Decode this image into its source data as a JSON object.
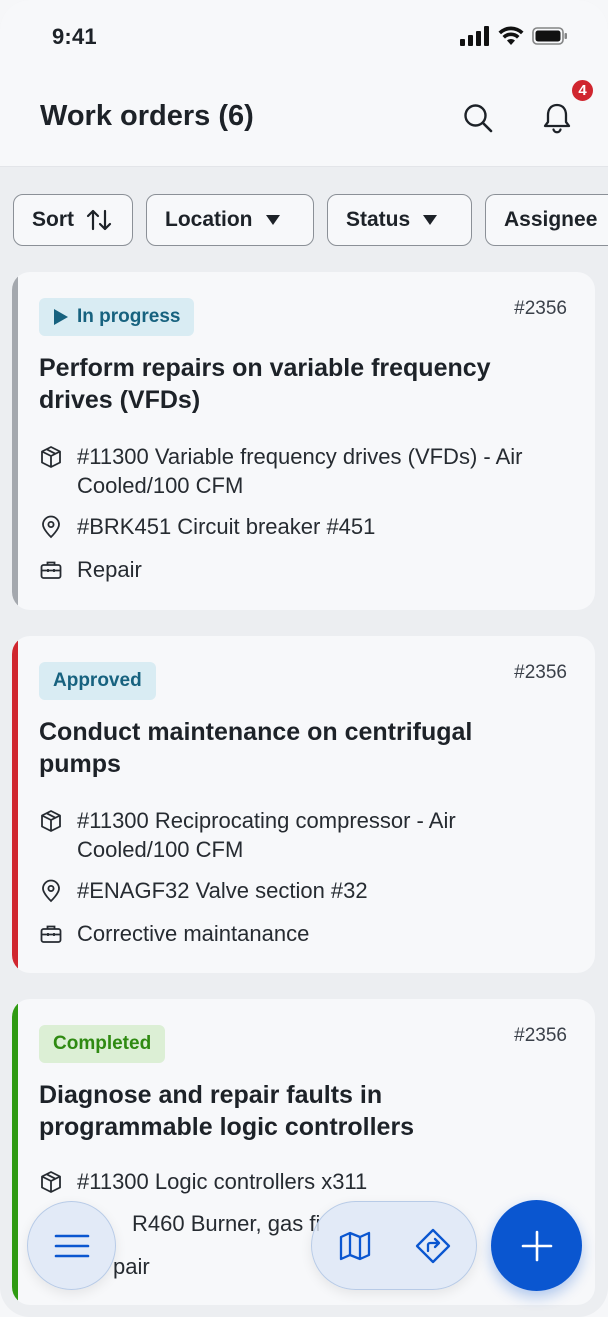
{
  "status_bar": {
    "time": "9:41"
  },
  "header": {
    "title": "Work orders (6)",
    "notification_count": "4"
  },
  "filters": [
    {
      "label": "Sort",
      "icon": "sort-arrows-icon"
    },
    {
      "label": "Location",
      "icon": "caret-down-icon"
    },
    {
      "label": "Status",
      "icon": "caret-down-icon"
    },
    {
      "label": "Assignee",
      "icon": "caret-down-icon"
    }
  ],
  "cards": [
    {
      "status": "In progress",
      "status_color": "#17627f",
      "status_bg": "#d9ecf3",
      "stripe_color": "#a4a8ae",
      "number": "#2356",
      "title": "Perform repairs on variable frequency drives (VFDs)",
      "asset": "#11300 Variable frequency drives (VFDs) - Air Cooled/100 CFM",
      "location": "#BRK451 Circuit breaker #451",
      "type": "Repair"
    },
    {
      "status": "Approved",
      "status_color": "#17627f",
      "status_bg": "#d9ecf3",
      "stripe_color": "#d0262f",
      "number": "#2356",
      "title": "Conduct maintenance on centrifugal pumps",
      "asset": "#11300 Reciprocating compressor - Air Cooled/100 CFM",
      "location": "#ENAGF32 Valve section #32",
      "type": "Corrective maintanance"
    },
    {
      "status": "Completed",
      "status_color": "#2f8a12",
      "status_bg": "#dcefd5",
      "stripe_color": "#2f9a12",
      "number": "#2356",
      "title": "Diagnose and repair faults in programmable logic controllers",
      "asset": "#11300 Logic controllers x311",
      "location": "R460 Burner, gas fi",
      "type": "pair"
    }
  ],
  "bottom_nav": {
    "menu_icon": "hamburger-menu-icon",
    "map_icon": "map-icon",
    "directions_icon": "directions-icon",
    "add_icon": "plus-icon",
    "accent": "#0a56d0"
  }
}
